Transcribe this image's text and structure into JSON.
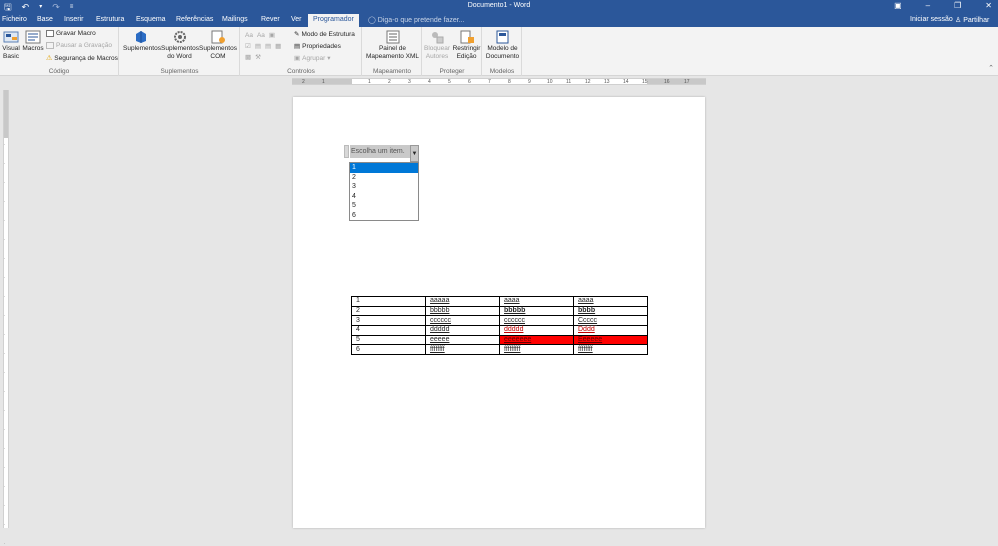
{
  "titlebar": {
    "title": "Documento1 - Word",
    "save_icon": "save-icon",
    "undo_icon": "undo-icon",
    "redo_icon": "redo-icon",
    "customize_icon": "customize-qat-icon"
  },
  "tabs": [
    "Ficheiro",
    "Base",
    "Inserir",
    "Estrutura",
    "Esquema",
    "Referências",
    "Mailings",
    "Rever",
    "Ver",
    "Programador"
  ],
  "active_tab": "Programador",
  "tell_me": "Diga-o que pretende fazer...",
  "account": {
    "signin": "Iniciar sessão",
    "share": "Partilhar"
  },
  "ribbon": {
    "codigo": {
      "label": "Código",
      "visual_basic": "Visual Basic",
      "macros": "Macros",
      "gravar_macro": "Gravar Macro",
      "pausar_gravacao": "Pausar a Gravação",
      "seguranca_macros": "Segurança de Macros"
    },
    "suplementos": {
      "label": "Suplementos",
      "suplementos": "Suplementos",
      "suplementos_word": "Suplementos do Word",
      "suplementos_com": "Suplementos COM"
    },
    "controlos": {
      "label": "Controlos",
      "modo_estrutura": "Modo de Estrutura",
      "propriedades": "Propriedades",
      "agrupar": "Agrupar"
    },
    "mapeamento": {
      "label": "Mapeamento",
      "painel": "Painel de Mapeamento XML"
    },
    "proteger": {
      "label": "Proteger",
      "bloquear": "Bloquear Autores",
      "restringir": "Restringir Edição"
    },
    "modelos": {
      "label": "Modelos",
      "modelo": "Modelo de Documento"
    }
  },
  "ruler_numbers": [
    "2",
    "1",
    "1",
    "2",
    "3",
    "4",
    "5",
    "6",
    "7",
    "8",
    "9",
    "10",
    "11",
    "12",
    "13",
    "14",
    "15",
    "16",
    "17"
  ],
  "content_control": {
    "placeholder": "Escolha um item.",
    "options": [
      "1",
      "2",
      "3",
      "4",
      "5",
      "6"
    ],
    "selected_index": 0
  },
  "table": {
    "rows": [
      [
        "1",
        "aaaaa",
        "aaaa",
        "aaaa"
      ],
      [
        "2",
        "bbbbb",
        "bbbbb",
        "bbbb"
      ],
      [
        "3",
        "cccccc",
        "cccccc",
        "Ccccc"
      ],
      [
        "4",
        "ddddd",
        "ddddd",
        "Dddd"
      ],
      [
        "5",
        "eeeee",
        "eeeeeee",
        "Eeeeee"
      ],
      [
        "6",
        "ffffffff",
        "fffffffff",
        "ffffffff"
      ]
    ]
  },
  "colors": {
    "title_blue": "#2b579a",
    "highlight_red": "#ff0000",
    "select_blue": "#0078d7"
  }
}
